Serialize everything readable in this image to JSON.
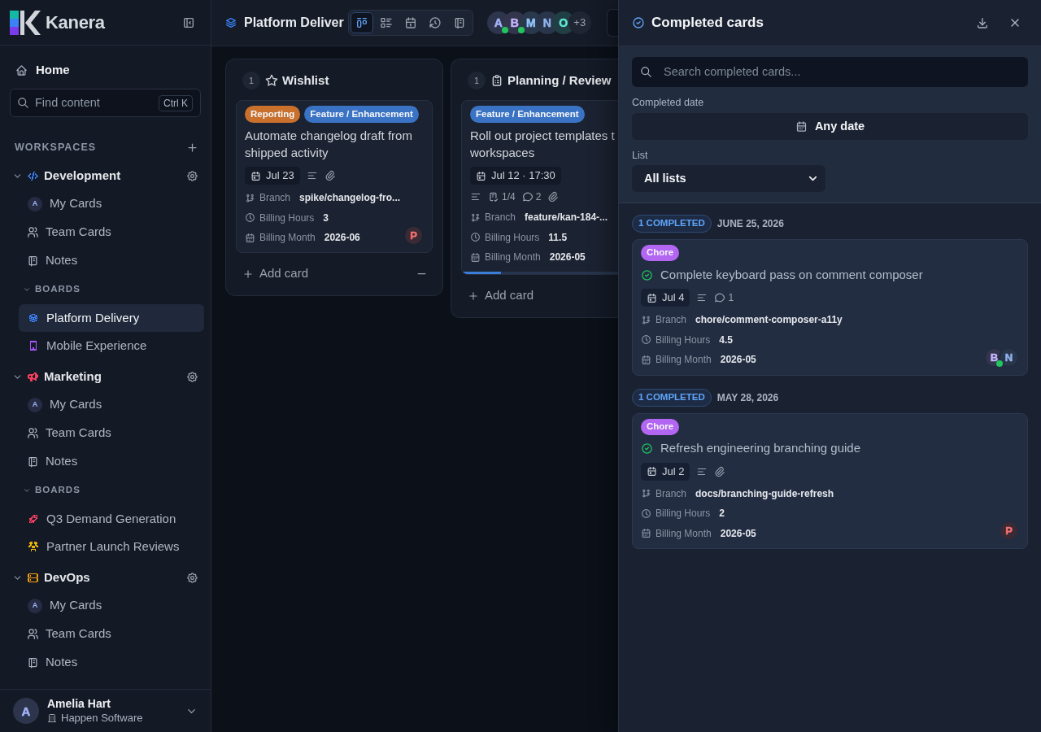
{
  "sidebar": {
    "brand": "Kanera",
    "home": "Home",
    "search": {
      "placeholder": "Find content",
      "shortcut": "Ctrl K"
    },
    "section_title": "WORKSPACES",
    "workspaces": [
      {
        "name": "Development",
        "color": "#3b82f6",
        "expanded": true,
        "items": [
          {
            "kind": "my_cards",
            "label": "My Cards",
            "avatar": "A"
          },
          {
            "kind": "team_cards",
            "label": "Team Cards"
          },
          {
            "kind": "notes",
            "label": "Notes"
          }
        ],
        "boards": {
          "label": "BOARDS",
          "expanded": true,
          "items": [
            {
              "label": "Platform Delivery",
              "color": "#3b82f6",
              "selected": true
            },
            {
              "label": "Mobile Experience",
              "color": "#a855f7",
              "selected": false
            }
          ]
        }
      },
      {
        "name": "Marketing",
        "color": "#f43f5e",
        "expanded": true,
        "items": [
          {
            "kind": "my_cards",
            "label": "My Cards",
            "avatar": "A"
          },
          {
            "kind": "team_cards",
            "label": "Team Cards"
          },
          {
            "kind": "notes",
            "label": "Notes"
          }
        ],
        "boards": {
          "label": "BOARDS",
          "expanded": true,
          "items": [
            {
              "label": "Q3 Demand Generation",
              "color": "#f43f5e",
              "selected": false
            },
            {
              "label": "Partner Launch Reviews",
              "color": "#eab308",
              "selected": false
            }
          ]
        }
      },
      {
        "name": "DevOps",
        "color": "#f59e0b",
        "expanded": true,
        "items": [
          {
            "kind": "my_cards",
            "label": "My Cards",
            "avatar": "A"
          },
          {
            "kind": "team_cards",
            "label": "Team Cards"
          },
          {
            "kind": "notes",
            "label": "Notes"
          }
        ]
      }
    ],
    "user": {
      "initial": "A",
      "name": "Amelia Hart",
      "org": "Happen Software"
    }
  },
  "header": {
    "title": "Platform Deliver",
    "views": [
      {
        "kind": "board",
        "selected": true
      },
      {
        "kind": "list",
        "selected": false
      },
      {
        "kind": "calendar",
        "selected": false
      },
      {
        "kind": "history",
        "selected": false
      },
      {
        "kind": "notes",
        "selected": false
      }
    ],
    "members": [
      {
        "initial": "A",
        "color": "#a5b4fc",
        "online": true
      },
      {
        "initial": "B",
        "color": "#c4b5fd",
        "online": true
      },
      {
        "initial": "M",
        "color": "#93c5fd",
        "online": false
      },
      {
        "initial": "N",
        "color": "#8fb4f0",
        "online": false
      },
      {
        "initial": "O",
        "color": "#5eead4",
        "online": false
      }
    ],
    "more_members": "+3"
  },
  "columns": [
    {
      "count": "1",
      "title": "Wishlist",
      "handle": true,
      "add_label": "Add card",
      "cards": [
        {
          "tags": [
            {
              "label": "Reporting",
              "color": "#c8702c"
            },
            {
              "label": "Feature / Enhancement",
              "color": "#3b73c4"
            }
          ],
          "title": "Automate changelog draft from shipped activity",
          "due": "Jul 23",
          "badges": [
            {
              "kind": "description"
            },
            {
              "kind": "attachment"
            }
          ],
          "fields": [
            {
              "kind": "branch",
              "label": "Branch",
              "value": "spike/changelog-fro..."
            },
            {
              "kind": "hours",
              "label": "Billing Hours",
              "value": "3"
            },
            {
              "kind": "month",
              "label": "Billing Month",
              "value": "2026-06"
            }
          ],
          "assignees": [
            {
              "initial": "P",
              "color": "#f87171",
              "online": false
            }
          ]
        }
      ]
    },
    {
      "count": "1",
      "title": "Planning / Review",
      "handle": false,
      "add_label": "Add card",
      "cards": [
        {
          "tags": [
            {
              "label": "Feature / Enhancement",
              "color": "#3b73c4"
            }
          ],
          "title": "Roll out project templates t\nworkspaces",
          "due": "Jul 12 · 17:30",
          "badges": [
            {
              "kind": "description"
            },
            {
              "kind": "checklist",
              "text": "1/4"
            },
            {
              "kind": "comments",
              "text": "2"
            },
            {
              "kind": "attachment"
            }
          ],
          "fields": [
            {
              "kind": "branch",
              "label": "Branch",
              "value": "feature/kan-184-..."
            },
            {
              "kind": "hours",
              "label": "Billing Hours",
              "value": "11.5"
            },
            {
              "kind": "month",
              "label": "Billing Month",
              "value": "2026-05"
            }
          ],
          "progress": {
            "level": 0.25
          }
        }
      ]
    }
  ],
  "drawer": {
    "title": "Completed cards",
    "search": {
      "placeholder": "Search completed cards..."
    },
    "date_filter": {
      "label": "Completed date",
      "value": "Any date"
    },
    "list_filter": {
      "label": "List",
      "value": "All lists"
    },
    "groups": [
      {
        "count": "1 COMPLETED",
        "date": "JUNE 25, 2026",
        "cards": [
          {
            "tags": [
              {
                "label": "Chore",
                "color": "#b366f2"
              }
            ],
            "completed": true,
            "title": "Complete keyboard pass on comment composer",
            "due": "Jul 4",
            "badges": [
              {
                "kind": "description"
              },
              {
                "kind": "comments",
                "text": "1"
              }
            ],
            "fields": [
              {
                "kind": "branch",
                "label": "Branch",
                "value": "chore/comment-composer-a11y"
              },
              {
                "kind": "hours",
                "label": "Billing Hours",
                "value": "4.5"
              },
              {
                "kind": "month",
                "label": "Billing Month",
                "value": "2026-05"
              }
            ],
            "assignees": [
              {
                "initial": "B",
                "color": "#c4b5fd",
                "online": true
              },
              {
                "initial": "N",
                "color": "#8fb4f0",
                "online": false
              }
            ]
          }
        ]
      },
      {
        "count": "1 COMPLETED",
        "date": "MAY 28, 2026",
        "cards": [
          {
            "tags": [
              {
                "label": "Chore",
                "color": "#b366f2"
              }
            ],
            "completed": true,
            "title": "Refresh engineering branching guide",
            "due": "Jul 2",
            "badges": [
              {
                "kind": "description"
              },
              {
                "kind": "attachment"
              }
            ],
            "fields": [
              {
                "kind": "branch",
                "label": "Branch",
                "value": "docs/branching-guide-refresh"
              },
              {
                "kind": "hours",
                "label": "Billing Hours",
                "value": "2"
              },
              {
                "kind": "month",
                "label": "Billing Month",
                "value": "2026-05"
              }
            ],
            "assignees": [
              {
                "initial": "P",
                "color": "#f87171",
                "online": false
              }
            ]
          }
        ]
      }
    ]
  }
}
